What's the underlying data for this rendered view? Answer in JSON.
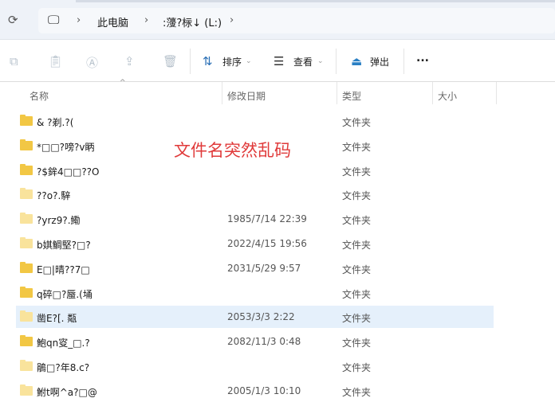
{
  "address": {
    "items": [
      "此电脑",
      ":薓?柡↓ (L:)"
    ]
  },
  "toolbar": {
    "sort": "排序",
    "view": "查看",
    "eject": "弹出",
    "more": "..."
  },
  "columns": {
    "name": "名称",
    "date": "修改日期",
    "type": "类型",
    "size": "大小"
  },
  "annotation": "文件名突然乱码",
  "files": [
    {
      "name": "&    ?剃.?(",
      "date": "",
      "type": "文件夹",
      "dark": true
    },
    {
      "name": "*□□?嗙?v眪",
      "date": "",
      "type": "文件夹",
      "dark": true
    },
    {
      "name": "?$鉾4□□??O",
      "date": "",
      "type": "文件夹",
      "dark": true
    },
    {
      "name": "??o?.騂",
      "date": "",
      "type": "文件夹",
      "dark": false
    },
    {
      "name": "?yrz9?.鰳",
      "date": "1985/7/14 22:39",
      "type": "文件夹",
      "dark": false
    },
    {
      "name": "b娸鯛堅?□?",
      "date": "2022/4/15 19:56",
      "type": "文件夹",
      "dark": false
    },
    {
      "name": "E□|晴??7□",
      "date": "2031/5/29 9:57",
      "type": "文件夹",
      "dark": true
    },
    {
      "name": "q碎□?蜃.(埇",
      "date": "",
      "type": "文件夹",
      "dark": true
    },
    {
      "name": "    凿E?[. 甐",
      "date": "2053/3/3 2:22",
      "type": "文件夹",
      "dark": false,
      "selected": true
    },
    {
      "name": "鮑qn叜_□.?",
      "date": "2082/11/3 0:48",
      "type": "文件夹",
      "dark": true
    },
    {
      "name": "鵑□?年8.c?",
      "date": "",
      "type": "文件夹",
      "dark": false
    },
    {
      "name": "鮒t啊^a?□@",
      "date": "2005/1/3 10:10",
      "type": "文件夹",
      "dark": false
    }
  ]
}
